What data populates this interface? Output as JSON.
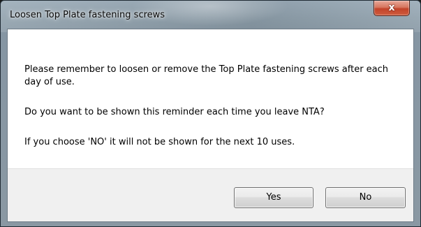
{
  "window": {
    "title": "Loosen Top Plate fastening screws",
    "close_glyph": "x"
  },
  "message": {
    "line1": "Please remember to loosen or remove the Top Plate fastening screws after each day of use.",
    "line2": "Do you want to be shown this reminder each time you leave NTA?",
    "line3": "If you choose 'NO' it will not be shown for the next 10 uses."
  },
  "buttons": {
    "yes_label": "Yes",
    "no_label": "No"
  },
  "colors": {
    "close_button": "#c2432a",
    "title_bar": "#8b9ca8",
    "button_strip": "#f0f0f0"
  },
  "icons": {
    "close": "close-icon"
  }
}
